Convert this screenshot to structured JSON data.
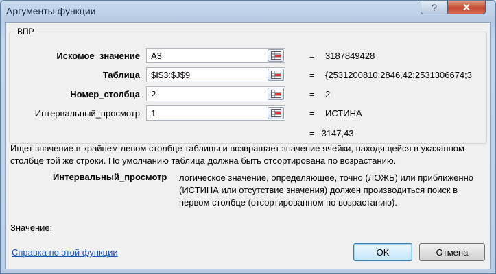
{
  "window": {
    "title": "Аргументы функции",
    "help_symbol": "?",
    "close_symbol": "✕"
  },
  "function_name": "ВПР",
  "args": [
    {
      "label": "Искомое_значение",
      "value": "A3",
      "result": "3187849428"
    },
    {
      "label": "Таблица",
      "value": "$I$3:$J$9",
      "result": "{2531200810;2846,42:2531306674;3"
    },
    {
      "label": "Номер_столбца",
      "value": "2",
      "result": "2"
    },
    {
      "label": "Интервальный_просмотр",
      "value": "1",
      "result": "ИСТИНА"
    }
  ],
  "equals_sign": "=",
  "formula_result": "3147,43",
  "description": "Ищет значение в крайнем левом столбце таблицы и возвращает значение ячейки, находящейся в указанном столбце той же строки. По умолчанию таблица должна быть отсортирована по возрастанию.",
  "param_help": {
    "name": "Интервальный_просмотр",
    "text": "логическое значение, определяющее, точно (ЛОЖЬ) или приближенно (ИСТИНА или отсутствие значения) должен производиться поиск в первом столбце (отсортированном по возрастанию)."
  },
  "value_label": "Значение:",
  "help_link": "Справка по этой функции",
  "buttons": {
    "ok": "OK",
    "cancel": "Отмена"
  },
  "icons": {
    "ref": "collapse-dialog-icon"
  }
}
